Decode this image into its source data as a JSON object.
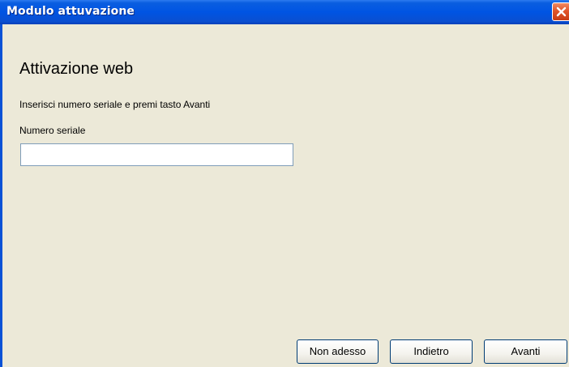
{
  "window": {
    "title": "Modulo attuvazione"
  },
  "content": {
    "heading": "Attivazione web",
    "instructions": "Inserisci numero seriale e premi tasto Avanti",
    "serial_label": "Numero seriale",
    "serial_value": "",
    "serial_placeholder": ""
  },
  "buttons": {
    "non_adesso": "Non adesso",
    "indietro": "Indietro",
    "avanti": "Avanti"
  },
  "colors": {
    "titlebar": "#0054e3",
    "close": "#e0552a",
    "background": "#ece9d8"
  },
  "icons": {
    "close": "close-icon"
  }
}
